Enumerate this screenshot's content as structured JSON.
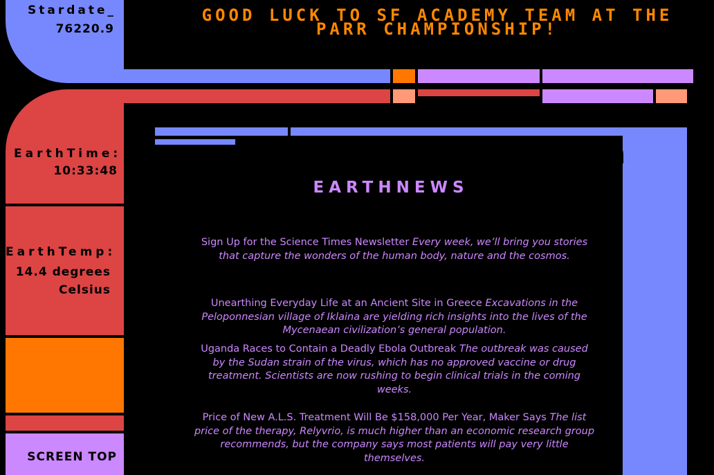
{
  "stardate": {
    "label": "Stardate_",
    "value": "76220.9"
  },
  "banner": "Good Luck to SF Academy Team at the PARR Championship!",
  "earth_time": {
    "label": "EarthTime:",
    "value": "10:33:48"
  },
  "earth_temp": {
    "label": "EarthTemp:",
    "value_line1": "14.4 degrees",
    "value_line2": "Celsius"
  },
  "screen_top_label": "SCREEN TOP",
  "news_title": "EARTHNEWS",
  "news": [
    {
      "headline": "Sign Up for the Science Times Newsletter",
      "description": "Every week, we’ll bring you stories that capture the wonders of the human body, nature and the cosmos."
    },
    {
      "headline": "Unearthing Everyday Life at an Ancient Site in Greece",
      "description": "Excavations in the Peloponnesian village of Iklaina are yielding rich insights into the lives of the Mycenaean civilization’s general population."
    },
    {
      "headline": "Uganda Races to Contain a Deadly Ebola Outbreak",
      "description": "The outbreak was caused by the Sudan strain of the virus, which has no approved vaccine or drug treatment. Scientists are now rushing to begin clinical trials in the coming weeks."
    },
    {
      "headline": "Price of New A.L.S. Treatment Will Be $158,000 Per Year, Maker Says",
      "description": "The list price of the therapy, Relyvrio, is much higher than an economic research group recommends, but the company says most patients will pay very little themselves."
    }
  ],
  "colors": {
    "blue": "#7788ff",
    "red": "#dd4444",
    "orange": "#ff7700",
    "lilac": "#cc88ff",
    "peach": "#ff9977"
  }
}
